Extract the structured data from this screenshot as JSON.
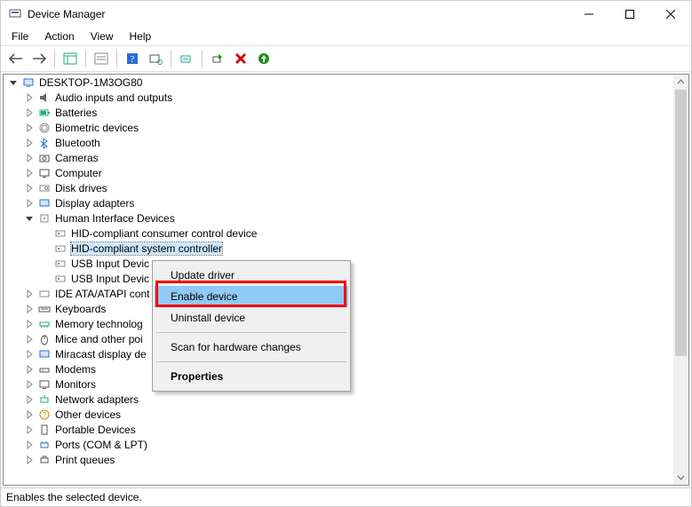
{
  "titlebar": {
    "title": "Device Manager"
  },
  "menubar": {
    "file": "File",
    "action": "Action",
    "view": "View",
    "help": "Help"
  },
  "tree": {
    "root": "DESKTOP-1M3OG80",
    "nodes": [
      {
        "label": "Audio inputs and outputs"
      },
      {
        "label": "Batteries"
      },
      {
        "label": "Biometric devices"
      },
      {
        "label": "Bluetooth"
      },
      {
        "label": "Cameras"
      },
      {
        "label": "Computer"
      },
      {
        "label": "Disk drives"
      },
      {
        "label": "Display adapters"
      },
      {
        "label": "Human Interface Devices",
        "expanded": true,
        "children": [
          {
            "label": "HID-compliant consumer control device"
          },
          {
            "label": "HID-compliant system controller",
            "selected": true
          },
          {
            "label": "USB Input Devic"
          },
          {
            "label": "USB Input Devic"
          }
        ]
      },
      {
        "label": "IDE ATA/ATAPI cont"
      },
      {
        "label": "Keyboards"
      },
      {
        "label": "Memory technolog"
      },
      {
        "label": "Mice and other poi"
      },
      {
        "label": "Miracast display de"
      },
      {
        "label": "Modems"
      },
      {
        "label": "Monitors"
      },
      {
        "label": "Network adapters"
      },
      {
        "label": "Other devices"
      },
      {
        "label": "Portable Devices"
      },
      {
        "label": "Ports (COM & LPT)"
      },
      {
        "label": "Print queues"
      }
    ]
  },
  "context_menu": {
    "update": "Update driver",
    "enable": "Enable device",
    "uninstall": "Uninstall device",
    "scan": "Scan for hardware changes",
    "properties": "Properties"
  },
  "statusbar": {
    "text": "Enables the selected device."
  }
}
